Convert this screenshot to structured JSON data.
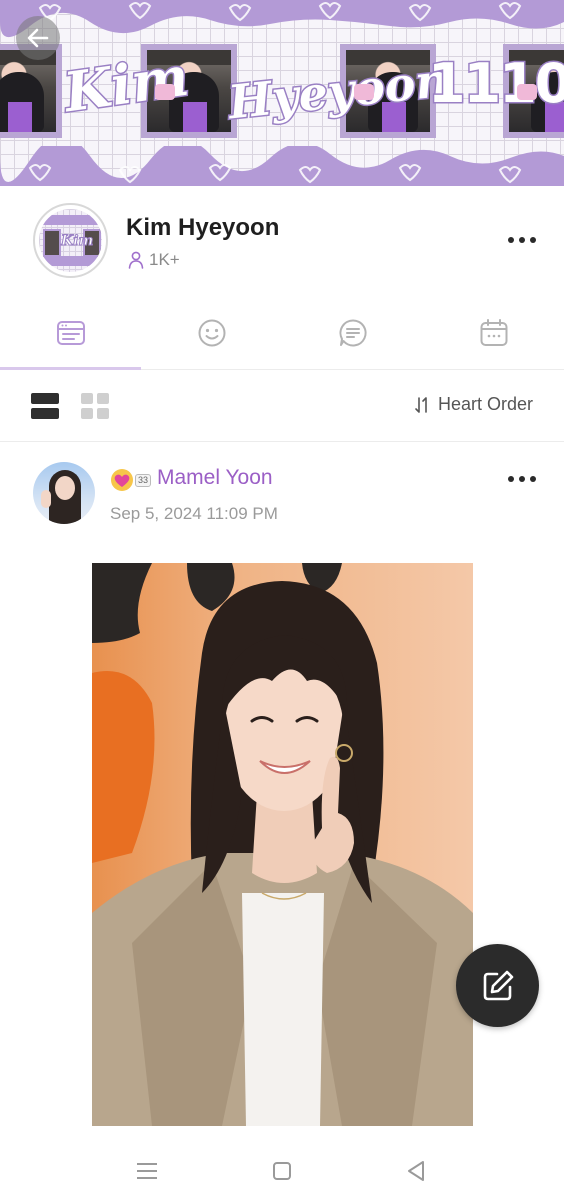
{
  "banner": {
    "words": [
      "Kim",
      "Hyeyoon",
      "1110"
    ],
    "accent_color": "#b39ad6"
  },
  "header": {
    "back_icon": "arrow-left-icon"
  },
  "profile": {
    "name": "Kim Hyeyoon",
    "member_count": "1K+",
    "member_icon": "person-icon",
    "more_icon": "more-horizontal-icon"
  },
  "tabs": [
    {
      "icon": "feed-board-icon",
      "active": true
    },
    {
      "icon": "smiley-icon",
      "active": false
    },
    {
      "icon": "chat-lines-icon",
      "active": false
    },
    {
      "icon": "calendar-icon",
      "active": false
    }
  ],
  "toolbar": {
    "list_view_icon": "list-view-icon",
    "grid_view_icon": "grid-view-icon",
    "sort_icon": "sort-arrows-icon",
    "sort_label": "Heart Order"
  },
  "post": {
    "author": "Mamel Yoon",
    "badge_icon": "heart-badge-icon",
    "level": "33",
    "timestamp": "Sep 5, 2024 11:09 PM",
    "more_icon": "more-horizontal-icon"
  },
  "fab": {
    "icon": "compose-icon"
  },
  "system_nav": [
    "menu-icon",
    "home-square-icon",
    "back-triangle-icon"
  ],
  "colors": {
    "brand_purple": "#9b5fc6",
    "tab_indicator": "#d9c8ec",
    "fab_bg": "#2b2b2b"
  }
}
